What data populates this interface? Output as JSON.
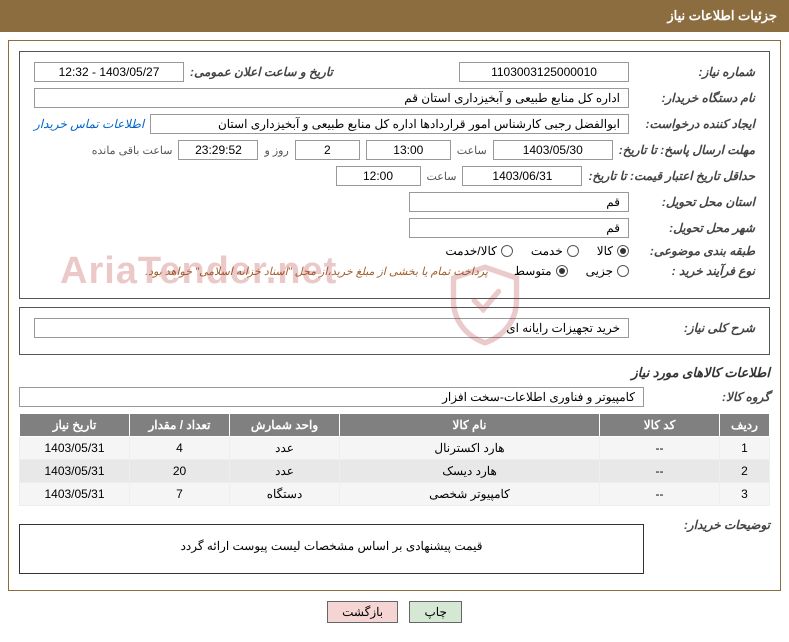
{
  "header": {
    "title": "جزئیات اطلاعات نیاز"
  },
  "fields": {
    "need_number_label": "شماره نیاز:",
    "need_number": "1103003125000010",
    "announce_label": "تاریخ و ساعت اعلان عمومی:",
    "announce_value": "1403/05/27 - 12:32",
    "buyer_org_label": "نام دستگاه خریدار:",
    "buyer_org": "اداره کل منابع طبیعی و آبخیزداری استان قم",
    "creator_label": "ایجاد کننده درخواست:",
    "creator": "ابوالفضل رجبی کارشناس امور قراردادها اداره کل منابع طبیعی و آبخیزداری استان",
    "contact_link": "اطلاعات تماس خریدار",
    "deadline_label": "مهلت ارسال پاسخ: تا تاریخ:",
    "deadline_date": "1403/05/30",
    "time_word": "ساعت",
    "deadline_time": "13:00",
    "days_remaining": "2",
    "days_word": "روز و",
    "countdown": "23:29:52",
    "remaining_word": "ساعت باقی مانده",
    "validity_label": "حداقل تاریخ اعتبار قیمت: تا تاریخ:",
    "validity_date": "1403/06/31",
    "validity_time": "12:00",
    "delivery_province_label": "استان محل تحویل:",
    "delivery_province": "قم",
    "delivery_city_label": "شهر محل تحویل:",
    "delivery_city": "قم",
    "category_label": "طبقه بندی موضوعی:",
    "process_type_label": "نوع فرآیند خرید :",
    "process_note": "پرداخت تمام یا بخشی از مبلغ خرید،از محل \"اسناد خزانه اسلامی\" خواهد بود."
  },
  "category_options": [
    {
      "label": "کالا",
      "checked": true
    },
    {
      "label": "خدمت",
      "checked": false
    },
    {
      "label": "کالا/خدمت",
      "checked": false
    }
  ],
  "process_options": [
    {
      "label": "جزیی",
      "checked": false
    },
    {
      "label": "متوسط",
      "checked": true
    }
  ],
  "description_section": {
    "label": "شرح کلی نیاز:",
    "value": "خرید تجهیزات رایانه ای"
  },
  "goods_section": {
    "title": "اطلاعات کالاهای مورد نیاز",
    "group_label": "گروه کالا:",
    "group_value": "کامپیوتر و فناوری اطلاعات-سخت افزار"
  },
  "table": {
    "headers": [
      "ردیف",
      "کد کالا",
      "نام کالا",
      "واحد شمارش",
      "تعداد / مقدار",
      "تاریخ نیاز"
    ],
    "rows": [
      {
        "idx": "1",
        "code": "--",
        "name": "هارد اکسترنال",
        "unit": "عدد",
        "qty": "4",
        "date": "1403/05/31"
      },
      {
        "idx": "2",
        "code": "--",
        "name": "هارد دیسک",
        "unit": "عدد",
        "qty": "20",
        "date": "1403/05/31"
      },
      {
        "idx": "3",
        "code": "--",
        "name": "کامپیوتر شخصی",
        "unit": "دستگاه",
        "qty": "7",
        "date": "1403/05/31"
      }
    ]
  },
  "buyer_notes": {
    "label": "توضیحات خریدار:",
    "text": "قیمت پیشنهادی بر اساس مشخصات لیست پیوست ارائه گردد"
  },
  "buttons": {
    "print": "چاپ",
    "back": "بازگشت"
  },
  "watermark": "AriaTender.net"
}
